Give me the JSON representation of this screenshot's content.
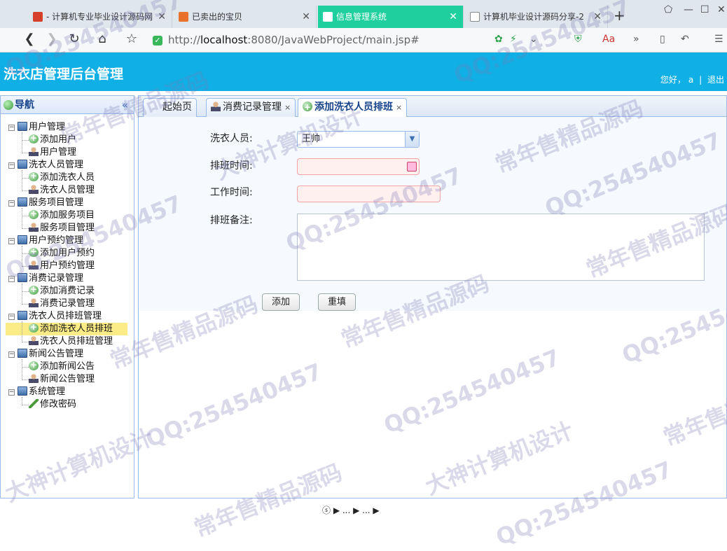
{
  "browser": {
    "tabs": [
      {
        "title": "- 计算机专业毕业设计源码网",
        "favicon_color": "#d6402a"
      },
      {
        "title": "已卖出的宝贝",
        "favicon_color": "#e8722a"
      },
      {
        "title": "信息管理系统",
        "favicon_color": "#ffffff",
        "active": true
      },
      {
        "title": "计算机毕业设计源码分享-2",
        "favicon_color": "#ffffff"
      }
    ],
    "address": {
      "scheme": "http://",
      "host": "localhost",
      "rest": ":8080/JavaWebProject/main.jsp#"
    }
  },
  "app": {
    "title": "洗衣店管理后台管理",
    "greeting": "您好，",
    "username": "a",
    "separator": "|",
    "logout": "退出"
  },
  "nav": {
    "title": "导航",
    "collapse_glyph": "«",
    "groups": [
      {
        "label": "用户管理",
        "items": [
          {
            "label": "添加用户",
            "icon": "add-icon"
          },
          {
            "label": "用户管理",
            "icon": "user-icon"
          }
        ]
      },
      {
        "label": "洗衣人员管理",
        "items": [
          {
            "label": "添加洗衣人员",
            "icon": "add-icon"
          },
          {
            "label": "洗衣人员管理",
            "icon": "user-icon"
          }
        ]
      },
      {
        "label": "服务项目管理",
        "items": [
          {
            "label": "添加服务项目",
            "icon": "add-icon"
          },
          {
            "label": "服务项目管理",
            "icon": "user-icon"
          }
        ]
      },
      {
        "label": "用户预约管理",
        "items": [
          {
            "label": "添加用户预约",
            "icon": "add-icon"
          },
          {
            "label": "用户预约管理",
            "icon": "user-icon"
          }
        ]
      },
      {
        "label": "消费记录管理",
        "items": [
          {
            "label": "添加消费记录",
            "icon": "add-icon"
          },
          {
            "label": "消费记录管理",
            "icon": "user-icon"
          }
        ]
      },
      {
        "label": "洗衣人员排班管理",
        "items": [
          {
            "label": "添加洗衣人员排班",
            "icon": "add-icon",
            "selected": true
          },
          {
            "label": "洗衣人员排班管理",
            "icon": "user-icon"
          }
        ]
      },
      {
        "label": "新闻公告管理",
        "items": [
          {
            "label": "添加新闻公告",
            "icon": "add-icon"
          },
          {
            "label": "新闻公告管理",
            "icon": "user-icon"
          }
        ]
      },
      {
        "label": "系统管理",
        "items": [
          {
            "label": "修改密码",
            "icon": "pen-icon"
          }
        ]
      }
    ]
  },
  "main": {
    "tabs": [
      {
        "label": "起始页",
        "closable": false
      },
      {
        "label": "消费记录管理",
        "closable": true
      },
      {
        "label": "添加洗衣人员排班",
        "closable": true,
        "active": true
      }
    ],
    "close_glyph": "×",
    "form": {
      "laundry_staff_label": "洗衣人员:",
      "laundry_staff_value": "王帅",
      "schedule_time_label": "排班时间:",
      "schedule_time_value": "",
      "work_time_label": "工作时间:",
      "work_time_value": "",
      "note_label": "排班备注:",
      "note_value": "",
      "add_button": "添加",
      "reset_button": "重填"
    }
  },
  "status_text": "ⓢ ▶ ... ▶ ... ▶",
  "watermark": {
    "qq": "QQ:254540457",
    "slogan1": "常年售精品源码",
    "slogan2": "大神计算机设计"
  }
}
